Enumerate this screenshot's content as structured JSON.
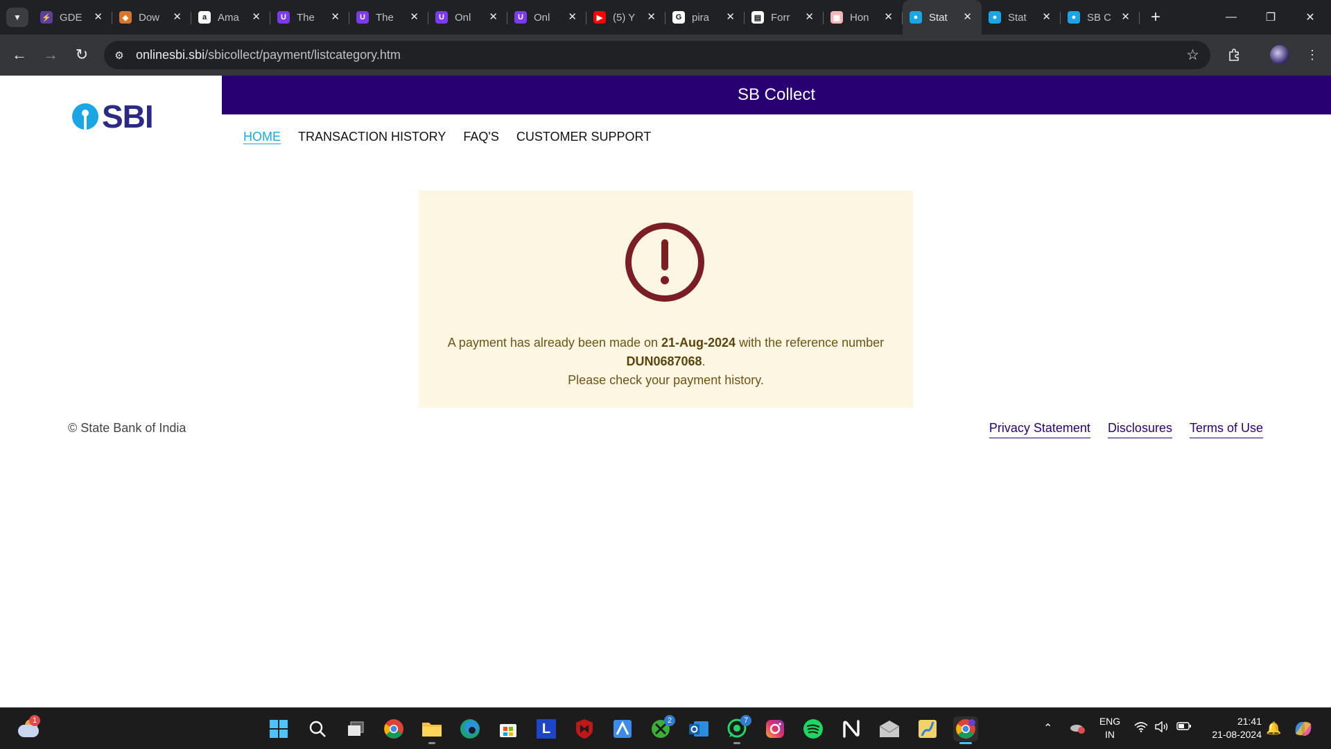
{
  "browser": {
    "tabs": [
      {
        "title": "GDE",
        "favicon_color": "#5b3fa0",
        "favicon_glyph": "⚡"
      },
      {
        "title": "Dow",
        "favicon_color": "#d9762a",
        "favicon_glyph": "◆"
      },
      {
        "title": "Ama",
        "favicon_color": "#ffffff",
        "favicon_glyph": "a"
      },
      {
        "title": "The",
        "favicon_color": "#7c3aed",
        "favicon_glyph": "U"
      },
      {
        "title": "The",
        "favicon_color": "#7c3aed",
        "favicon_glyph": "U"
      },
      {
        "title": "Onl",
        "favicon_color": "#7c3aed",
        "favicon_glyph": "U"
      },
      {
        "title": "Onl",
        "favicon_color": "#7c3aed",
        "favicon_glyph": "U"
      },
      {
        "title": "(5) Y",
        "favicon_color": "#ff0000",
        "favicon_glyph": "▶"
      },
      {
        "title": "pira",
        "favicon_color": "#ffffff",
        "favicon_glyph": "G"
      },
      {
        "title": "Forr",
        "favicon_color": "#ffffff",
        "favicon_glyph": "▤"
      },
      {
        "title": "Hon",
        "favicon_color": "#f4b6b6",
        "favicon_glyph": "▦"
      },
      {
        "title": "Stat",
        "favicon_color": "#1aa6e4",
        "favicon_glyph": "●",
        "active": true
      },
      {
        "title": "Stat",
        "favicon_color": "#1aa6e4",
        "favicon_glyph": "●"
      },
      {
        "title": "SB C",
        "favicon_color": "#1aa6e4",
        "favicon_glyph": "●"
      }
    ],
    "url": {
      "host": "onlinesbi.sbi",
      "path": "/sbicollect/payment/listcategory.htm"
    }
  },
  "site": {
    "logo_text": "SBI",
    "brand_title": "SB Collect",
    "menu": [
      {
        "label": "HOME",
        "active": true
      },
      {
        "label": "TRANSACTION HISTORY"
      },
      {
        "label": "FAQ'S"
      },
      {
        "label": "CUSTOMER SUPPORT"
      }
    ],
    "alert": {
      "text_before": "A payment has already been made on ",
      "date": "21-Aug-2024",
      "text_middle": " with the reference number ",
      "reference": "DUN0687068",
      "text_after": ".",
      "line2": "Please check your payment history."
    },
    "footer": {
      "copyright": "© State Bank of India",
      "links": [
        "Privacy Statement",
        "Disclosures",
        "Terms of Use"
      ]
    }
  },
  "taskbar": {
    "weather_badge": "1",
    "xbox_badge": "2",
    "whatsapp_badge": "7",
    "language_line1": "ENG",
    "language_line2": "IN",
    "time": "21:41",
    "date": "21-08-2024"
  }
}
